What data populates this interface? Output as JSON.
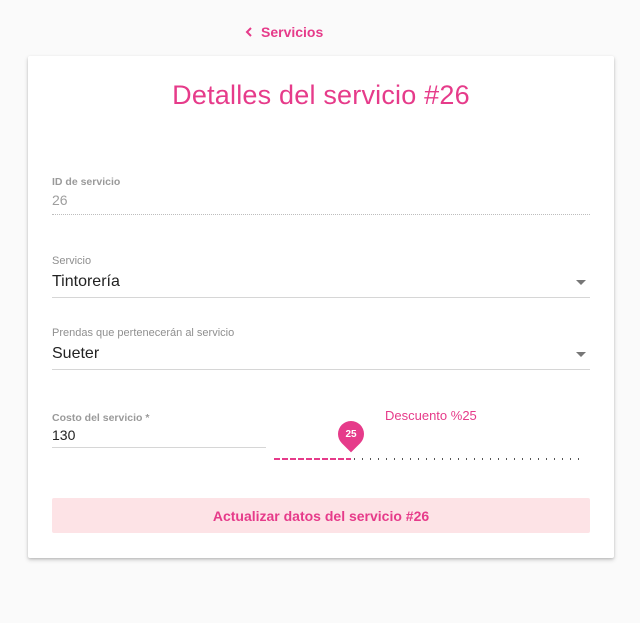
{
  "nav": {
    "back_label": "Servicios"
  },
  "card": {
    "title": "Detalles del servicio #26"
  },
  "fields": {
    "service_id": {
      "label": "ID de servicio",
      "value": "26"
    },
    "service": {
      "label": "Servicio",
      "value": "Tintorería"
    },
    "garments": {
      "label": "Prendas que pertenecerán al servicio",
      "value": "Sueter"
    },
    "cost": {
      "label": "Costo del servicio *",
      "value": "130"
    }
  },
  "discount": {
    "label": "Descuento %25",
    "value": 25,
    "min": 0,
    "max": 100,
    "pin_value": "25"
  },
  "actions": {
    "update_label": "Actualizar datos del servicio #26"
  },
  "colors": {
    "accent": "#e63b8a",
    "button_bg": "#fde3e6"
  }
}
